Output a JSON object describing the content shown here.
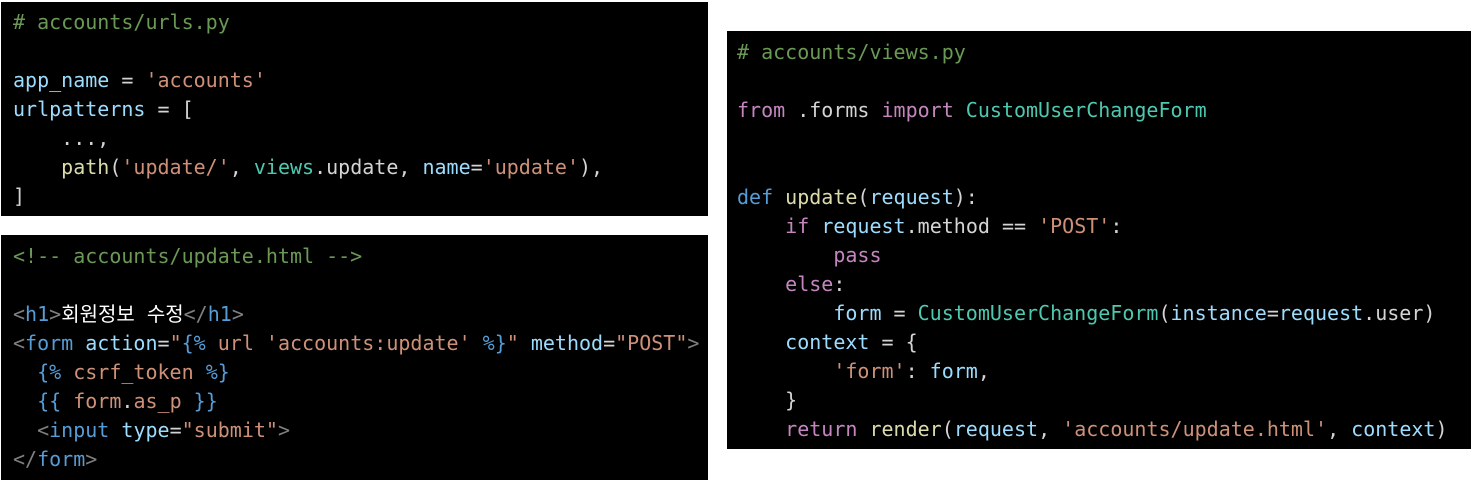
{
  "panels": [
    {
      "name": "accounts-urls-code",
      "lines": [
        [
          [
            "# accounts/urls.py",
            "com"
          ]
        ],
        [],
        [
          [
            "app_name",
            "var"
          ],
          [
            " = ",
            "plain"
          ],
          [
            "'accounts'",
            "str"
          ]
        ],
        [
          [
            "urlpatterns",
            "var"
          ],
          [
            " = [",
            "plain"
          ]
        ],
        [
          [
            "    ...,",
            "plain"
          ]
        ],
        [
          [
            "    ",
            "plain"
          ],
          [
            "path",
            "fn"
          ],
          [
            "(",
            "plain"
          ],
          [
            "'update/'",
            "str"
          ],
          [
            ", ",
            "plain"
          ],
          [
            "views",
            "cls"
          ],
          [
            ".",
            "plain"
          ],
          [
            "update",
            "plain"
          ],
          [
            ", ",
            "plain"
          ],
          [
            "name",
            "var"
          ],
          [
            "=",
            "plain"
          ],
          [
            "'update'",
            "str"
          ],
          [
            "),",
            "plain"
          ]
        ],
        [
          [
            "]",
            "plain"
          ]
        ]
      ]
    },
    {
      "name": "accounts-update-html-code",
      "lines": [
        [
          [
            "<!-- accounts/update.html -->",
            "com"
          ]
        ],
        [],
        [
          [
            "<",
            "punct"
          ],
          [
            "h1",
            "tag"
          ],
          [
            ">",
            "punct"
          ],
          [
            "회원정보 수정",
            "text"
          ],
          [
            "</",
            "punct"
          ],
          [
            "h1",
            "tag"
          ],
          [
            ">",
            "punct"
          ]
        ],
        [
          [
            "<",
            "punct"
          ],
          [
            "form",
            "tag"
          ],
          [
            " ",
            "plain"
          ],
          [
            "action",
            "var"
          ],
          [
            "=",
            "plain"
          ],
          [
            "\"",
            "str"
          ],
          [
            "{%",
            "tag"
          ],
          [
            " url 'accounts:update' ",
            "str"
          ],
          [
            "%}",
            "tag"
          ],
          [
            "\"",
            "str"
          ],
          [
            " ",
            "plain"
          ],
          [
            "method",
            "var"
          ],
          [
            "=",
            "plain"
          ],
          [
            "\"POST\"",
            "str"
          ],
          [
            ">",
            "punct"
          ]
        ],
        [
          [
            "  ",
            "plain"
          ],
          [
            "{%",
            "tag"
          ],
          [
            " csrf_token ",
            "str"
          ],
          [
            "%}",
            "tag"
          ]
        ],
        [
          [
            "  ",
            "plain"
          ],
          [
            "{{",
            "tag"
          ],
          [
            " form",
            "str"
          ],
          [
            ".",
            "plain"
          ],
          [
            "as_p",
            "str"
          ],
          [
            " ",
            "plain"
          ],
          [
            "}}",
            "tag"
          ]
        ],
        [
          [
            "  ",
            "plain"
          ],
          [
            "<",
            "punct"
          ],
          [
            "input",
            "tag"
          ],
          [
            " ",
            "plain"
          ],
          [
            "type",
            "var"
          ],
          [
            "=",
            "plain"
          ],
          [
            "\"submit\"",
            "str"
          ],
          [
            ">",
            "punct"
          ]
        ],
        [
          [
            "</",
            "punct"
          ],
          [
            "form",
            "tag"
          ],
          [
            ">",
            "punct"
          ]
        ]
      ]
    },
    {
      "name": "accounts-views-code",
      "lines": [
        [
          [
            "# accounts/views.py",
            "com"
          ]
        ],
        [],
        [
          [
            "from",
            "kw"
          ],
          [
            " .forms ",
            "plain"
          ],
          [
            "import",
            "kw"
          ],
          [
            " ",
            "plain"
          ],
          [
            "CustomUserChangeForm",
            "cls"
          ]
        ],
        [],
        [],
        [
          [
            "def",
            "def"
          ],
          [
            " ",
            "plain"
          ],
          [
            "update",
            "fn"
          ],
          [
            "(",
            "plain"
          ],
          [
            "request",
            "var"
          ],
          [
            "):",
            "plain"
          ]
        ],
        [
          [
            "    ",
            "plain"
          ],
          [
            "if",
            "kw"
          ],
          [
            " ",
            "plain"
          ],
          [
            "request",
            "var"
          ],
          [
            ".",
            "plain"
          ],
          [
            "method",
            "plain"
          ],
          [
            " == ",
            "plain"
          ],
          [
            "'POST'",
            "str"
          ],
          [
            ":",
            "plain"
          ]
        ],
        [
          [
            "        ",
            "plain"
          ],
          [
            "pass",
            "kw"
          ]
        ],
        [
          [
            "    ",
            "plain"
          ],
          [
            "else",
            "kw"
          ],
          [
            ":",
            "plain"
          ]
        ],
        [
          [
            "        ",
            "plain"
          ],
          [
            "form",
            "var"
          ],
          [
            " = ",
            "plain"
          ],
          [
            "CustomUserChangeForm",
            "cls"
          ],
          [
            "(",
            "plain"
          ],
          [
            "instance",
            "var"
          ],
          [
            "=",
            "plain"
          ],
          [
            "request",
            "var"
          ],
          [
            ".",
            "plain"
          ],
          [
            "user",
            "plain"
          ],
          [
            ")",
            "plain"
          ]
        ],
        [
          [
            "    ",
            "plain"
          ],
          [
            "context",
            "var"
          ],
          [
            " = {",
            "plain"
          ]
        ],
        [
          [
            "        ",
            "plain"
          ],
          [
            "'form'",
            "str"
          ],
          [
            ": ",
            "plain"
          ],
          [
            "form",
            "var"
          ],
          [
            ",",
            "plain"
          ]
        ],
        [
          [
            "    }",
            "plain"
          ]
        ],
        [
          [
            "    ",
            "plain"
          ],
          [
            "return",
            "kw"
          ],
          [
            " ",
            "plain"
          ],
          [
            "render",
            "fn"
          ],
          [
            "(",
            "plain"
          ],
          [
            "request",
            "var"
          ],
          [
            ", ",
            "plain"
          ],
          [
            "'accounts/update.html'",
            "str"
          ],
          [
            ", ",
            "plain"
          ],
          [
            "context",
            "var"
          ],
          [
            ")",
            "plain"
          ]
        ]
      ]
    }
  ]
}
